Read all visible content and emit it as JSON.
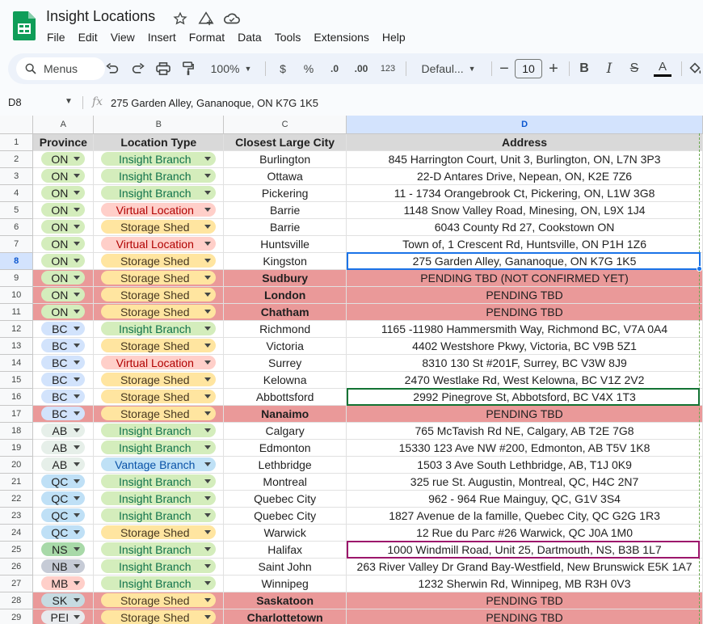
{
  "doc": {
    "title": "Insight Locations",
    "menus": [
      "File",
      "Edit",
      "View",
      "Insert",
      "Format",
      "Data",
      "Tools",
      "Extensions",
      "Help"
    ]
  },
  "toolbar": {
    "search_label": "Menus",
    "zoom": "100%",
    "currency": "$",
    "percent": "%",
    "dec_decrease": ".0",
    "dec_increase": ".00",
    "number_format": "123",
    "font_name": "Defaul...",
    "font_size": "10",
    "bold": "B",
    "italic": "I",
    "strike": "S",
    "text_color": "A"
  },
  "formula_bar": {
    "cell_ref": "D8",
    "fx": "fx",
    "value": "275 Garden Alley, Gananoque, ON K7G 1K5"
  },
  "columns": [
    "A",
    "B",
    "C",
    "D"
  ],
  "headers": [
    "Province",
    "Location Type",
    "Closest Large City",
    "Address"
  ],
  "colors": {
    "pending_bg": "#ea9999",
    "header_bg": "#d9d9d9",
    "selection": "#1a73e8",
    "accent": "#0b57d0"
  },
  "chip_colors": {
    "ON": "#d4edbc",
    "BC": "#d2e3fc",
    "AB": "#e6efe9",
    "QC": "#bfe0f6",
    "NS": "#a8d9a8",
    "NB": "#c6cbd6",
    "MB": "#ffcfc9",
    "SK": "#c6dbe1",
    "PEI": "#e8eaed",
    "Insight Branch": "#d4edbc",
    "Virtual Location": "#ffcfc9",
    "Storage Shed": "#ffe5a0",
    "Vantage Branch": "#bfe1f6"
  },
  "chip_text": {
    "Insight Branch": "#11734b",
    "Virtual Location": "#b10202",
    "Storage Shed": "#473821",
    "Vantage Branch": "#0a53a8",
    "default": "#1f1f1f"
  },
  "rows": [
    {
      "num": "2",
      "province": "ON",
      "type": "Insight Branch",
      "city": "Burlington",
      "address": "845 Harrington Court, Unit 3, Burlington, ON, L7N 3P3",
      "pending": false
    },
    {
      "num": "3",
      "province": "ON",
      "type": "Insight Branch",
      "city": "Ottawa",
      "address": "22-D Antares Drive, Nepean, ON, K2E 7Z6",
      "pending": false
    },
    {
      "num": "4",
      "province": "ON",
      "type": "Insight Branch",
      "city": "Pickering",
      "address": "11 - 1734 Orangebrook Ct, Pickering, ON, L1W 3G8",
      "pending": false
    },
    {
      "num": "5",
      "province": "ON",
      "type": "Virtual Location",
      "city": "Barrie",
      "address": "1148 Snow Valley Road, Minesing, ON, L9X 1J4",
      "pending": false
    },
    {
      "num": "6",
      "province": "ON",
      "type": "Storage Shed",
      "city": "Barrie",
      "address": "6043 County Rd 27, Cookstown ON",
      "pending": false
    },
    {
      "num": "7",
      "province": "ON",
      "type": "Virtual Location",
      "city": "Huntsville",
      "address": "Town of, 1 Crescent Rd, Huntsville, ON P1H 1Z6",
      "pending": false
    },
    {
      "num": "8",
      "province": "ON",
      "type": "Storage Shed",
      "city": "Kingston",
      "address": "275 Garden Alley, Gananoque, ON K7G 1K5",
      "pending": false
    },
    {
      "num": "9",
      "province": "ON",
      "type": "Storage Shed",
      "city": "Sudbury",
      "address": "PENDING TBD (NOT CONFIRMED YET)",
      "pending": true
    },
    {
      "num": "10",
      "province": "ON",
      "type": "Storage Shed",
      "city": "London",
      "address": "PENDING TBD",
      "pending": true
    },
    {
      "num": "11",
      "province": "ON",
      "type": "Storage Shed",
      "city": "Chatham",
      "address": "PENDING TBD",
      "pending": true
    },
    {
      "num": "12",
      "province": "BC",
      "type": "Insight Branch",
      "city": "Richmond",
      "address": "1165 -11980 Hammersmith Way, Richmond BC, V7A 0A4",
      "pending": false
    },
    {
      "num": "13",
      "province": "BC",
      "type": "Storage Shed",
      "city": "Victoria",
      "address": "4402 Westshore Pkwy, Victoria, BC V9B 5Z1",
      "pending": false
    },
    {
      "num": "14",
      "province": "BC",
      "type": "Virtual Location",
      "city": "Surrey",
      "address": "8310 130 St #201F, Surrey, BC V3W 8J9",
      "pending": false
    },
    {
      "num": "15",
      "province": "BC",
      "type": "Storage Shed",
      "city": "Kelowna",
      "address": "2470 Westlake Rd, West Kelowna, BC V1Z 2V2",
      "pending": false
    },
    {
      "num": "16",
      "province": "BC",
      "type": "Storage Shed",
      "city": "Abbottsford",
      "address": "2992 Pinegrove St, Abbotsford, BC V4X 1T3",
      "pending": false
    },
    {
      "num": "17",
      "province": "BC",
      "type": "Storage Shed",
      "city": "Nanaimo",
      "address": "PENDING TBD",
      "pending": true
    },
    {
      "num": "18",
      "province": "AB",
      "type": "Insight Branch",
      "city": "Calgary",
      "address": "765 McTavish Rd NE, Calgary, AB T2E 7G8",
      "pending": false
    },
    {
      "num": "19",
      "province": "AB",
      "type": "Insight Branch",
      "city": "Edmonton",
      "address": "15330 123 Ave NW #200, Edmonton, AB T5V 1K8",
      "pending": false
    },
    {
      "num": "20",
      "province": "AB",
      "type": "Vantage Branch",
      "city": "Lethbridge",
      "address": "1503 3 Ave South Lethbridge, AB, T1J 0K9",
      "pending": false
    },
    {
      "num": "21",
      "province": "QC",
      "type": "Insight Branch",
      "city": "Montreal",
      "address": "325 rue St. Augustin, Montreal, QC, H4C 2N7",
      "pending": false
    },
    {
      "num": "22",
      "province": "QC",
      "type": "Insight Branch",
      "city": "Quebec City",
      "address": "962 - 964 Rue Mainguy, QC, G1V 3S4",
      "pending": false
    },
    {
      "num": "23",
      "province": "QC",
      "type": "Insight Branch",
      "city": "Quebec City",
      "address": "1827 Avenue de la famille, Quebec City, QC G2G 1R3",
      "pending": false
    },
    {
      "num": "24",
      "province": "QC",
      "type": "Storage Shed",
      "city": "Warwick",
      "address": "12 Rue du Parc #26 Warwick, QC J0A 1M0",
      "pending": false
    },
    {
      "num": "25",
      "province": "NS",
      "type": "Insight Branch",
      "city": "Halifax",
      "address": "1000 Windmill Road, Unit 25, Dartmouth, NS, B3B 1L7",
      "pending": false
    },
    {
      "num": "26",
      "province": "NB",
      "type": "Insight Branch",
      "city": "Saint John",
      "address": "263 River Valley Dr Grand Bay-Westfield, New Brunswick E5K 1A7",
      "pending": false
    },
    {
      "num": "27",
      "province": "MB",
      "type": "Insight Branch",
      "city": "Winnipeg",
      "address": "1232 Sherwin Rd, Winnipeg, MB R3H 0V3",
      "pending": false
    },
    {
      "num": "28",
      "province": "SK",
      "type": "Storage Shed",
      "city": "Saskatoon",
      "address": "PENDING TBD",
      "pending": true
    },
    {
      "num": "29",
      "province": "PEI",
      "type": "Storage Shed",
      "city": "Charlottetown",
      "address": "PENDING TBD",
      "pending": true
    }
  ]
}
